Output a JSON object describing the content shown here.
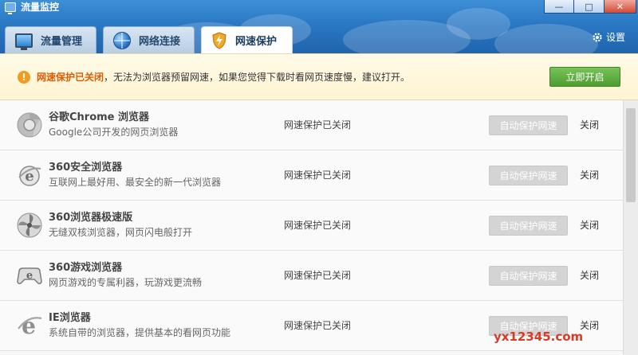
{
  "window": {
    "title": "流量监控",
    "min_glyph": "—",
    "max_glyph": "□",
    "close_glyph": "✕"
  },
  "tabs": [
    {
      "label": "流量管理",
      "icon": "monitor-icon",
      "active": false
    },
    {
      "label": "网络连接",
      "icon": "globe-icon",
      "active": false
    },
    {
      "label": "网速保护",
      "icon": "lightning-shield-icon",
      "active": true
    }
  ],
  "settings": {
    "label": "设置",
    "icon": "gear-icon"
  },
  "notice": {
    "icon_glyph": "!",
    "strong": "网速保护已关闭",
    "text": "，无法为浏览器预留网速，如果您觉得下载时看网页速度慢，建议打开。",
    "button": "立即开启"
  },
  "browsers": [
    {
      "name": "谷歌Chrome 浏览器",
      "desc": "Google公司开发的网页浏览器",
      "status": "网速保护已关闭",
      "button": "自动保护网速",
      "close": "关闭",
      "icon": "chrome-icon"
    },
    {
      "name": "360安全浏览器",
      "desc": "互联网上最好用、最安全的新一代浏览器",
      "status": "网速保护已关闭",
      "button": "自动保护网速",
      "close": "关闭",
      "icon": "360-safe-browser-icon"
    },
    {
      "name": "360浏览器极速版",
      "desc": "无缝双核浏览器，网页闪电般打开",
      "status": "网速保护已关闭",
      "button": "自动保护网速",
      "close": "关闭",
      "icon": "360-speed-browser-icon"
    },
    {
      "name": "360游戏浏览器",
      "desc": "网页游戏的专属利器，玩游戏更流畅",
      "status": "网速保护已关闭",
      "button": "自动保护网速",
      "close": "关闭",
      "icon": "360-game-browser-icon"
    },
    {
      "name": "IE浏览器",
      "desc": "系统自带的浏览器，提供基本的看网页功能",
      "status": "网速保护已关闭",
      "button": "自动保护网速",
      "close": "关闭",
      "icon": "ie-icon"
    }
  ],
  "watermark": "yx12345.com",
  "colors": {
    "title_blue": "#2a78c4",
    "notice_orange": "#e05a00",
    "open_green": "#4d9d2f",
    "disabled_gray": "#d4d4d4"
  }
}
